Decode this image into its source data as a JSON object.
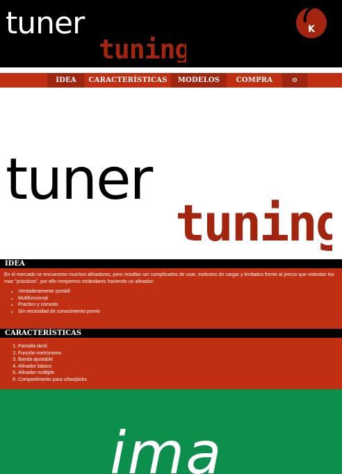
{
  "brand": {
    "logo_text_1": "tuner",
    "logo_text_2": "tuning",
    "badge_letter": "K",
    "colors": {
      "black": "#000000",
      "red": "#c12f12",
      "dark_red": "#9e2510",
      "logo_red": "#a3250f",
      "green": "#0c8f4d"
    }
  },
  "nav": {
    "items": [
      {
        "label": "IDEA"
      },
      {
        "label": "CARACTERÍSTICAS"
      },
      {
        "label": "MODELOS"
      },
      {
        "label": "COMPRA"
      },
      {
        "label": "⊖"
      }
    ]
  },
  "idea": {
    "title": "IDEA",
    "paragraph": "En el mercado se encuentran muchos afinadores, pero resultan ser complicados de usar, molestos de cargar y limitados frente al precio que ostentan los mas \"prácticos\", por ello rompemos estándares haciendo un afinador:",
    "bullets": [
      "Verdaderamente portátil",
      "Multifuncional",
      "Practico y cómodo",
      "Sin necesidad de conocimiento previo"
    ]
  },
  "caracteristicas": {
    "title": "CARACTERÍSTICAS",
    "items": [
      "Pantalla táctil",
      "Función metrónomo",
      "Banda ajustable",
      "Afinador básico",
      "Afinador múltiple",
      "Compartimento para uñas/picks"
    ]
  },
  "image_placeholder": {
    "text": "ima"
  }
}
